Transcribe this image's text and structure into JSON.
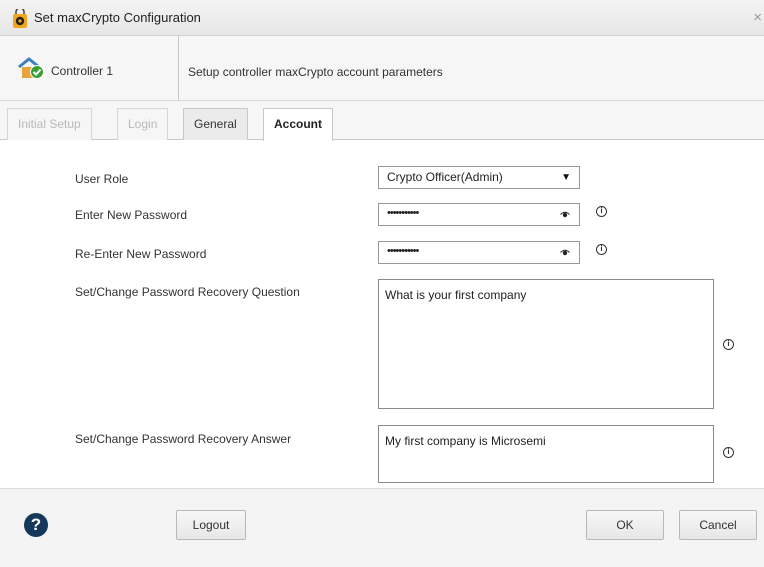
{
  "window": {
    "title": "Set maxCrypto Configuration",
    "close_glyph": "×"
  },
  "header": {
    "controller_label": "Controller 1",
    "description": "Setup controller maxCrypto account parameters"
  },
  "tabs": [
    {
      "label": "Initial Setup",
      "state": "disabled"
    },
    {
      "label": "Login",
      "state": "disabled"
    },
    {
      "label": "General",
      "state": "normal"
    },
    {
      "label": "Account",
      "state": "active"
    }
  ],
  "form": {
    "user_role_label": "User Role",
    "user_role_value": "Crypto Officer(Admin)",
    "new_password_label": "Enter New Password",
    "new_password_value": "•••••••••••",
    "reenter_password_label": "Re-Enter New Password",
    "reenter_password_value": "•••••••••••",
    "recovery_question_label": "Set/Change Password Recovery Question",
    "recovery_question_value": "What is your first company",
    "recovery_answer_label": "Set/Change Password Recovery Answer",
    "recovery_answer_value": "My first company is Microsemi",
    "info_glyph": "i"
  },
  "footer": {
    "help_glyph": "?",
    "logout_label": "Logout",
    "ok_label": "OK",
    "cancel_label": "Cancel"
  },
  "colors": {
    "help_icon_bg": "#14385a",
    "check_green": "#3aa035",
    "roof_blue": "#3d7fc1"
  },
  "icons": [
    "app-gear-icon",
    "controller-check-icon",
    "eye-icon",
    "info-icon",
    "help-icon",
    "close-icon"
  ]
}
